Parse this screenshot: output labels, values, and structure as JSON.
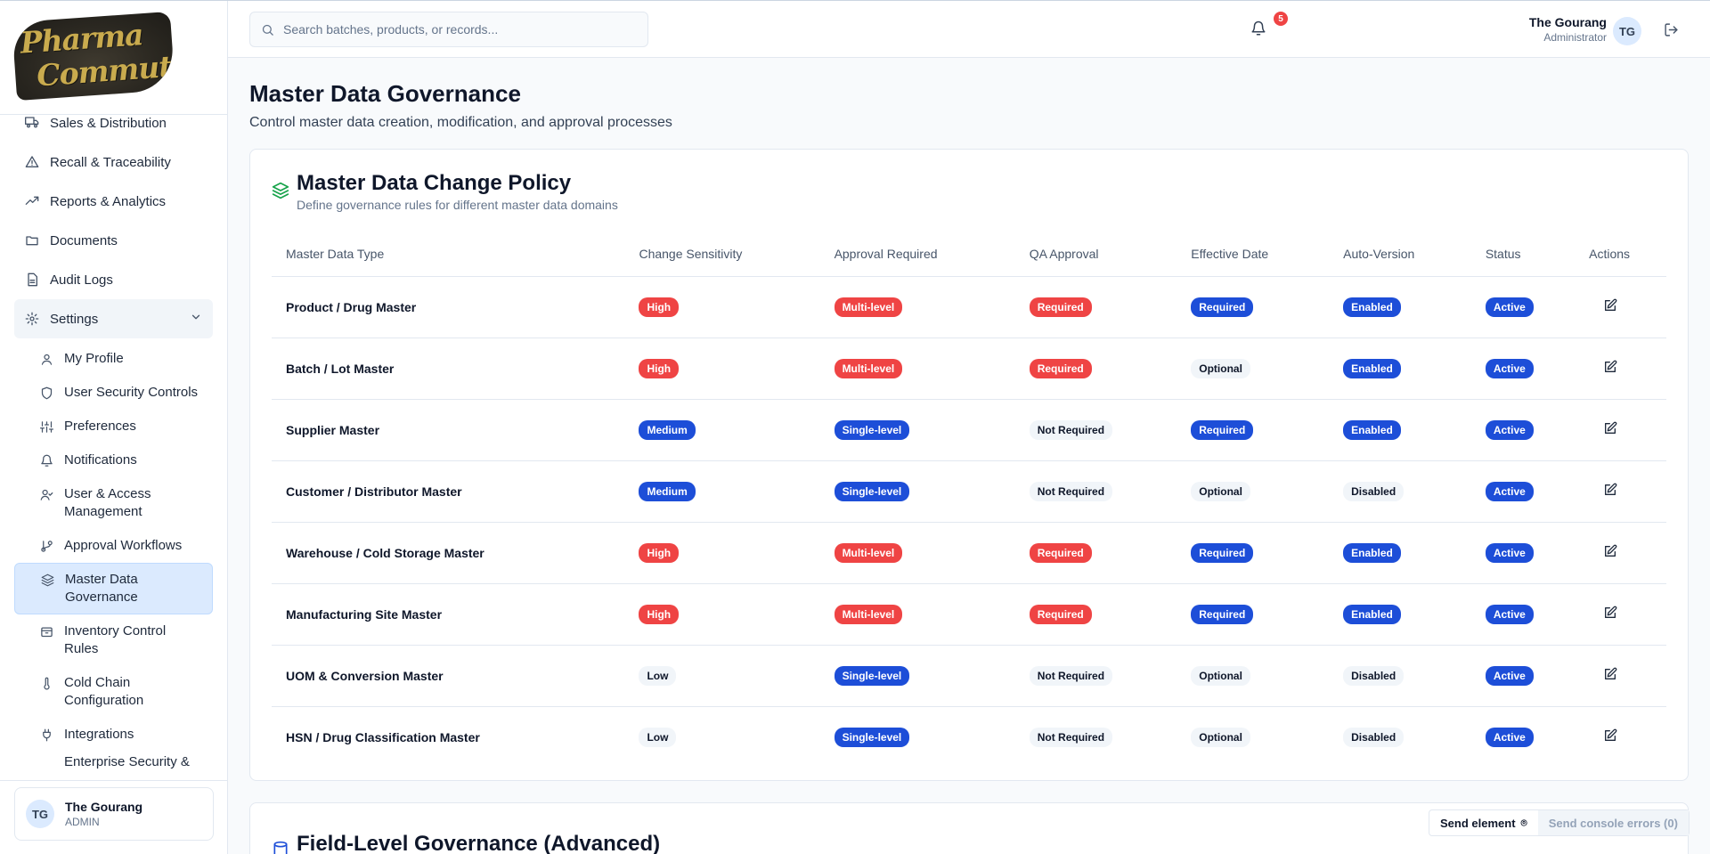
{
  "brand": {
    "logo_line1": "Pharma",
    "logo_line2": "Commute"
  },
  "search": {
    "placeholder": "Search batches, products, or records..."
  },
  "header": {
    "notification_count": "5",
    "user_name": "The Gourang",
    "user_role": "Administrator",
    "user_initials": "TG"
  },
  "sidebar": {
    "items": [
      {
        "label": "Sales & Distribution",
        "icon": "truck-icon"
      },
      {
        "label": "Recall & Traceability",
        "icon": "alert-triangle-icon"
      },
      {
        "label": "Reports & Analytics",
        "icon": "trending-up-icon"
      },
      {
        "label": "Documents",
        "icon": "folder-icon"
      },
      {
        "label": "Audit Logs",
        "icon": "file-text-icon"
      }
    ],
    "settings_label": "Settings",
    "sub_items": [
      {
        "label": "My Profile",
        "icon": "user-icon"
      },
      {
        "label": "User Security Controls",
        "icon": "shield-icon"
      },
      {
        "label": "Preferences",
        "icon": "sliders-icon"
      },
      {
        "label": "Notifications",
        "icon": "bell-icon"
      },
      {
        "label": "User & Access Management",
        "icon": "user-check-icon"
      },
      {
        "label": "Approval Workflows",
        "icon": "git-branch-icon"
      },
      {
        "label": "Master Data Governance",
        "icon": "layers-icon"
      },
      {
        "label": "Inventory Control Rules",
        "icon": "package-icon"
      },
      {
        "label": "Cold Chain Configuration",
        "icon": "thermometer-icon"
      },
      {
        "label": "Integrations",
        "icon": "plug-icon"
      },
      {
        "label": "Enterprise Security &",
        "icon": "lock-icon"
      }
    ],
    "user": {
      "initials": "TG",
      "name": "The Gourang",
      "role": "ADMIN"
    }
  },
  "page": {
    "title": "Master Data Governance",
    "subtitle": "Control master data creation, modification, and approval processes"
  },
  "policy_card": {
    "title": "Master Data Change Policy",
    "subtitle": "Define governance rules for different master data domains",
    "columns": [
      "Master Data Type",
      "Change Sensitivity",
      "Approval Required",
      "QA Approval",
      "Effective Date",
      "Auto-Version",
      "Status",
      "Actions"
    ],
    "rows": [
      {
        "type": "Product / Drug Master",
        "sensitivity": "High",
        "approval": "Multi-level",
        "qa": "Required",
        "effective": "Required",
        "auto_version": "Enabled",
        "status": "Active"
      },
      {
        "type": "Batch / Lot Master",
        "sensitivity": "High",
        "approval": "Multi-level",
        "qa": "Required",
        "effective": "Optional",
        "auto_version": "Enabled",
        "status": "Active"
      },
      {
        "type": "Supplier Master",
        "sensitivity": "Medium",
        "approval": "Single-level",
        "qa": "Not Required",
        "effective": "Required",
        "auto_version": "Enabled",
        "status": "Active"
      },
      {
        "type": "Customer / Distributor Master",
        "sensitivity": "Medium",
        "approval": "Single-level",
        "qa": "Not Required",
        "effective": "Optional",
        "auto_version": "Disabled",
        "status": "Active"
      },
      {
        "type": "Warehouse / Cold Storage Master",
        "sensitivity": "High",
        "approval": "Multi-level",
        "qa": "Required",
        "effective": "Required",
        "auto_version": "Enabled",
        "status": "Active"
      },
      {
        "type": "Manufacturing Site Master",
        "sensitivity": "High",
        "approval": "Multi-level",
        "qa": "Required",
        "effective": "Required",
        "auto_version": "Enabled",
        "status": "Active"
      },
      {
        "type": "UOM & Conversion Master",
        "sensitivity": "Low",
        "approval": "Single-level",
        "qa": "Not Required",
        "effective": "Optional",
        "auto_version": "Disabled",
        "status": "Active"
      },
      {
        "type": "HSN / Drug Classification Master",
        "sensitivity": "Low",
        "approval": "Single-level",
        "qa": "Not Required",
        "effective": "Optional",
        "auto_version": "Disabled",
        "status": "Active"
      }
    ]
  },
  "field_card": {
    "title": "Field-Level Governance (Advanced)"
  },
  "devtools": {
    "send_element": "Send element",
    "console_errors": "Send console errors (0)"
  },
  "colors": {
    "accent": "#1d4ed8",
    "danger": "#ef4444",
    "neutral_badge": "#f1f5f9",
    "active_nav": "#dbeafe"
  }
}
